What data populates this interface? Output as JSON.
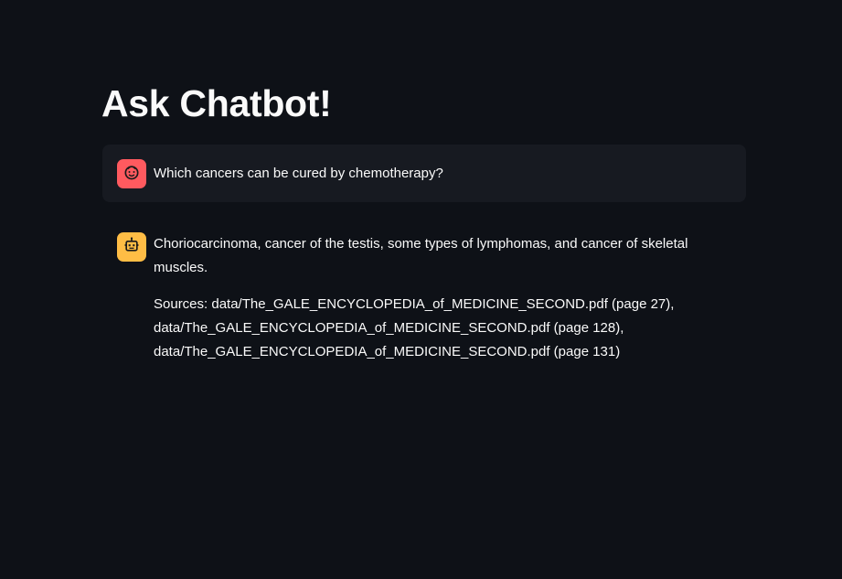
{
  "page": {
    "title": "Ask Chatbot!"
  },
  "chat": {
    "user_message": {
      "avatar_icon": "face-icon",
      "text": "Which cancers can be cured by chemotherapy?"
    },
    "assistant_message": {
      "avatar_icon": "robot-icon",
      "answer": "Choriocarcinoma, cancer of the testis, some types of lymphomas, and cancer of skeletal muscles.",
      "sources_lines": [
        "Sources: data/The_GALE_ENCYCLOPEDIA_of_MEDICINE_SECOND.pdf (page 27),",
        "data/The_GALE_ENCYCLOPEDIA_of_MEDICINE_SECOND.pdf (page 128),",
        "data/The_GALE_ENCYCLOPEDIA_of_MEDICINE_SECOND.pdf (page 131)"
      ]
    }
  },
  "colors": {
    "background": "#0e1117",
    "user_bubble": "#171a21",
    "user_avatar": "#ff5a5f",
    "assistant_avatar": "#ffbd45",
    "text": "#fafafa"
  }
}
